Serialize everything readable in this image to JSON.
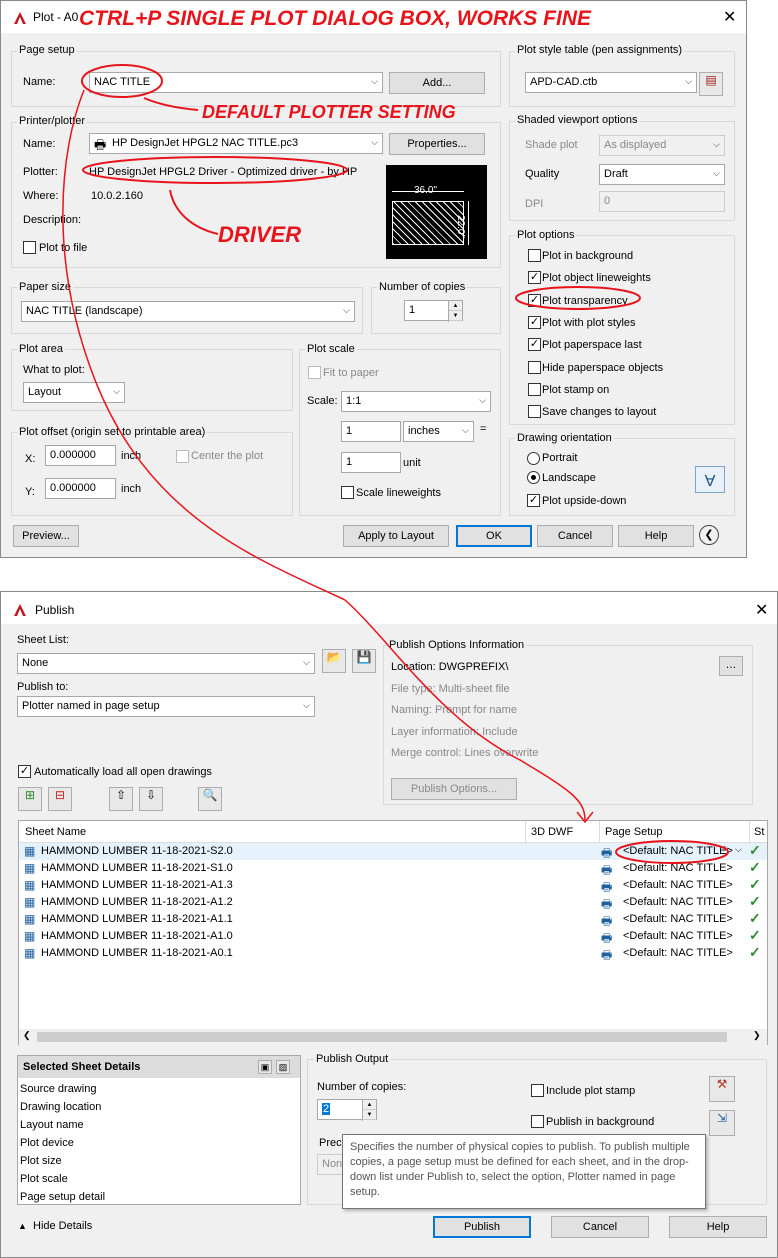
{
  "annotations": {
    "top_banner": "CTRL+P SINGLE PLOT DIALOG BOX, WORKS FINE",
    "plotter_note": "DEFAULT PLOTTER SETTING",
    "driver_note": "DRIVER"
  },
  "plot": {
    "title": "Plot - A0",
    "page_setup": {
      "group": "Page setup",
      "name_label": "Name:",
      "name_value": "NAC TITLE",
      "add_button": "Add..."
    },
    "printer": {
      "group": "Printer/plotter",
      "name_label": "Name:",
      "name_value": "HP DesignJet HPGL2 NAC TITLE.pc3",
      "properties_button": "Properties...",
      "plotter_label": "Plotter:",
      "plotter_value": "HP DesignJet HPGL2 Driver - Optimized driver - by HP",
      "where_label": "Where:",
      "where_value": "10.0.2.160",
      "description_label": "Description:",
      "plot_to_file": "Plot to file",
      "preview_width": "36.0\"",
      "preview_height": "22.0\""
    },
    "paper_size": {
      "group": "Paper size",
      "value": "NAC TITLE (landscape)"
    },
    "copies": {
      "group": "Number of copies",
      "value": "1"
    },
    "plot_area": {
      "group": "Plot area",
      "what_label": "What to plot:",
      "value": "Layout"
    },
    "plot_scale": {
      "group": "Plot scale",
      "fit": "Fit to paper",
      "scale_label": "Scale:",
      "scale_value": "1:1",
      "value1": "1",
      "unit1": "inches",
      "value2": "1",
      "unit2": "unit",
      "equals": "=",
      "scale_lw": "Scale lineweights"
    },
    "offset": {
      "group": "Plot offset (origin set to printable area)",
      "x_label": "X:",
      "x_value": "0.000000",
      "x_unit": "inch",
      "y_label": "Y:",
      "y_value": "0.000000",
      "y_unit": "inch",
      "center": "Center the plot"
    },
    "style_table": {
      "group": "Plot style table (pen assignments)",
      "value": "APD-CAD.ctb"
    },
    "shaded": {
      "group": "Shaded viewport options",
      "shade_label": "Shade plot",
      "shade_value": "As displayed",
      "quality_label": "Quality",
      "quality_value": "Draft",
      "dpi_label": "DPI",
      "dpi_value": "0"
    },
    "options": {
      "group": "Plot options",
      "items": [
        {
          "label": "Plot in background",
          "checked": false
        },
        {
          "label": "Plot object lineweights",
          "checked": true
        },
        {
          "label": "Plot transparency",
          "checked": true
        },
        {
          "label": "Plot with plot styles",
          "checked": true
        },
        {
          "label": "Plot paperspace last",
          "checked": true
        },
        {
          "label": "Hide paperspace objects",
          "checked": false
        },
        {
          "label": "Plot stamp on",
          "checked": false
        },
        {
          "label": "Save changes to layout",
          "checked": false
        }
      ]
    },
    "orientation": {
      "group": "Drawing orientation",
      "portrait": "Portrait",
      "landscape": "Landscape",
      "upside": "Plot upside-down"
    },
    "buttons": {
      "preview": "Preview...",
      "apply": "Apply to Layout",
      "ok": "OK",
      "cancel": "Cancel",
      "help": "Help"
    }
  },
  "publish": {
    "title": "Publish",
    "sheet_list_label": "Sheet List:",
    "sheet_list_value": "None",
    "publish_to_label": "Publish to:",
    "publish_to_value": "Plotter named in page setup",
    "info": {
      "group": "Publish Options Information",
      "location": "Location: DWGPREFIX\\",
      "file_type": "File type: Multi-sheet file",
      "naming": "Naming: Prompt for name",
      "layer": "Layer information: Include",
      "merge": "Merge control: Lines overwrite",
      "options_button": "Publish Options..."
    },
    "auto_load": "Automatically load all open drawings",
    "columns": {
      "sheet": "Sheet Name",
      "dwf": "3D DWF",
      "setup": "Page Setup",
      "status": "St"
    },
    "sheets": [
      {
        "name": "HAMMOND LUMBER 11-18-2021-S2.0",
        "setup": "<Default: NAC TITLE>"
      },
      {
        "name": "HAMMOND LUMBER 11-18-2021-S1.0",
        "setup": "<Default: NAC TITLE>"
      },
      {
        "name": "HAMMOND LUMBER 11-18-2021-A1.3",
        "setup": "<Default: NAC TITLE>"
      },
      {
        "name": "HAMMOND LUMBER 11-18-2021-A1.2",
        "setup": "<Default: NAC TITLE>"
      },
      {
        "name": "HAMMOND LUMBER 11-18-2021-A1.1",
        "setup": "<Default: NAC TITLE>"
      },
      {
        "name": "HAMMOND LUMBER 11-18-2021-A1.0",
        "setup": "<Default: NAC TITLE>"
      },
      {
        "name": "HAMMOND LUMBER 11-18-2021-A0.1",
        "setup": "<Default: NAC TITLE>"
      }
    ],
    "details": {
      "header": "Selected Sheet Details",
      "items": [
        "Source drawing",
        "Drawing location",
        "Layout name",
        "Plot device",
        "Plot size",
        "Plot scale",
        "Page setup detail"
      ]
    },
    "output": {
      "group": "Publish Output",
      "copies_label": "Number of copies:",
      "copies_value": "2",
      "precision_label": "Preci",
      "precision_value": "None",
      "include_stamp": "Include plot stamp",
      "background": "Publish in background"
    },
    "tooltip": "Specifies the number of physical copies to publish. To publish multiple copies, a page setup must be defined for each sheet, and in the drop-down list under Publish to, select the option, Plotter named in page setup.",
    "hide_details": "Hide Details",
    "buttons": {
      "publish": "Publish",
      "cancel": "Cancel",
      "help": "Help"
    }
  }
}
